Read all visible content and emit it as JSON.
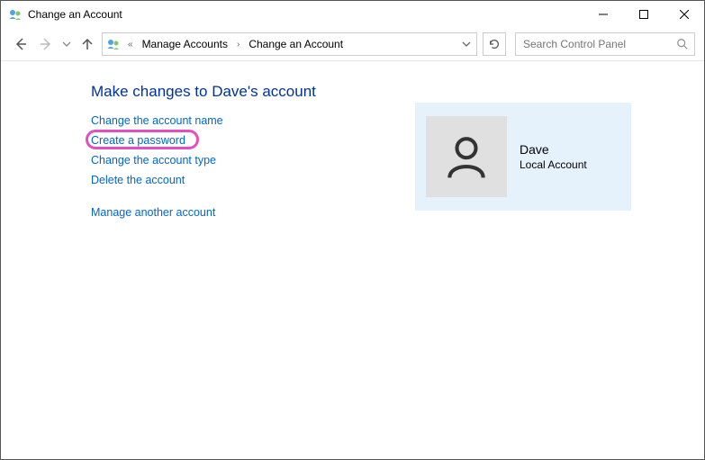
{
  "window": {
    "title": "Change an Account"
  },
  "breadcrumb": {
    "item1": "Manage Accounts",
    "item2": "Change an Account"
  },
  "search": {
    "placeholder": "Search Control Panel"
  },
  "heading": "Make changes to Dave's account",
  "links": {
    "change_name": "Change the account name",
    "create_password": "Create a password",
    "change_type": "Change the account type",
    "delete_account": "Delete the account",
    "manage_another": "Manage another account"
  },
  "account": {
    "name": "Dave",
    "type": "Local Account"
  }
}
